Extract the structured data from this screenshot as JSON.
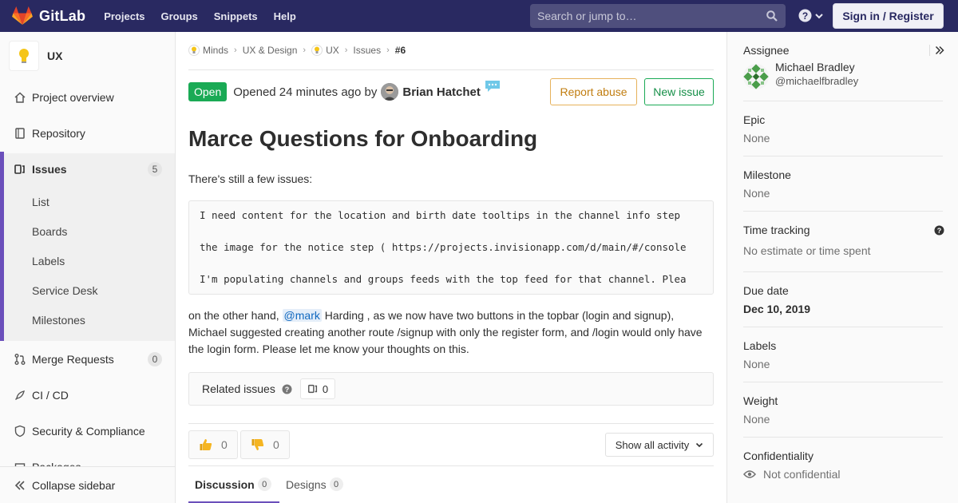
{
  "navbar": {
    "brand": "GitLab",
    "links": [
      "Projects",
      "Groups",
      "Snippets",
      "Help"
    ],
    "search_placeholder": "Search or jump to…",
    "signin_label": "Sign in / Register"
  },
  "sidebar": {
    "project_name": "UX",
    "items": {
      "overview": "Project overview",
      "repository": "Repository",
      "issues": "Issues",
      "issues_count": "5",
      "merge_requests": "Merge Requests",
      "merge_requests_count": "0",
      "cicd": "CI / CD",
      "security": "Security & Compliance",
      "partial": "Packages"
    },
    "issue_subitems": [
      "List",
      "Boards",
      "Labels",
      "Service Desk",
      "Milestones"
    ],
    "collapse_label": "Collapse sidebar"
  },
  "breadcrumb": [
    "Minds",
    "UX & Design",
    "UX",
    "Issues",
    "#6"
  ],
  "issue": {
    "status": "Open",
    "opened_text": "Opened 24 minutes ago by",
    "author": "Brian Hatchet",
    "report_label": "Report abuse",
    "new_issue_label": "New issue",
    "title": "Marce Questions for Onboarding",
    "intro": "There's still a few issues:",
    "code_lines": [
      "I need content for the location and birth date tooltips in the channel info step",
      "the image for the notice step ( https://projects.invisionapp.com/d/main/#/console",
      "I'm populating channels and groups feeds with the top feed for that channel. Plea"
    ],
    "para_before": "on the other hand, ",
    "mention": "@mark",
    "para_after": " Harding , as we now have two buttons in the topbar (login and signup), Michael suggested creating another route /signup with only the register form, and /login would only have the login form. Please let me know your thoughts on this.",
    "related_label": "Related issues",
    "related_count": "0",
    "thumbs_up": "0",
    "thumbs_down": "0",
    "activity_label": "Show all activity",
    "tabs": {
      "discussion": "Discussion",
      "discussion_count": "0",
      "designs": "Designs",
      "designs_count": "0"
    }
  },
  "right_sidebar": {
    "assignee_label": "Assignee",
    "assignee_name": "Michael Bradley",
    "assignee_user": "@michaelfbradley",
    "epic_label": "Epic",
    "epic_value": "None",
    "milestone_label": "Milestone",
    "milestone_value": "None",
    "time_label": "Time tracking",
    "time_value": "No estimate or time spent",
    "due_label": "Due date",
    "due_value": "Dec 10, 2019",
    "labels_label": "Labels",
    "labels_value": "None",
    "weight_label": "Weight",
    "weight_value": "None",
    "conf_label": "Confidentiality",
    "conf_value": "Not confidential"
  },
  "colors": {
    "navbar": "#292961",
    "accent": "#6b4fbb",
    "open": "#1aaa55",
    "report": "#e6b15b"
  }
}
